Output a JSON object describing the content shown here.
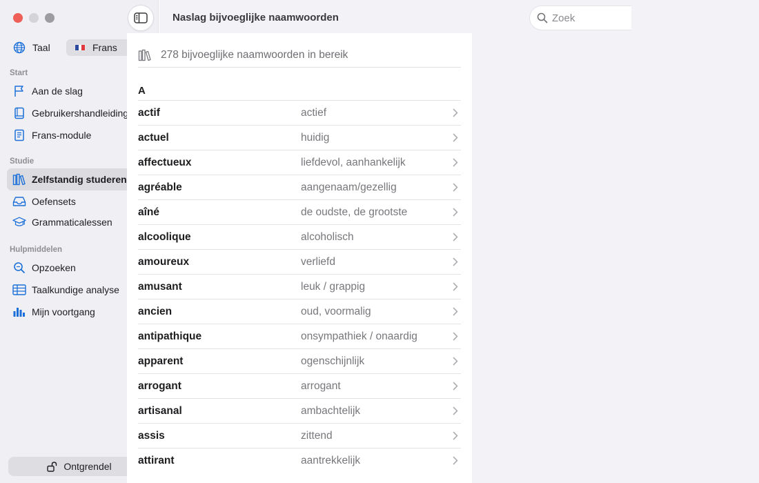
{
  "window": {
    "controls": [
      "close",
      "minimize",
      "zoom"
    ]
  },
  "sidebar": {
    "language": {
      "label": "Taal",
      "selected": "Frans",
      "flag_colors": [
        "#2b4aa0",
        "#ffffff",
        "#e0383e"
      ]
    },
    "sections": [
      {
        "title": "Start",
        "items": [
          {
            "label": "Aan de slag",
            "icon": "flag-icon"
          },
          {
            "label": "Gebruikershandleiding",
            "icon": "book-icon"
          },
          {
            "label": "Frans-module",
            "icon": "module-icon"
          }
        ]
      },
      {
        "title": "Studie",
        "items": [
          {
            "label": "Zelfstandig studeren",
            "icon": "library-icon",
            "active": true
          },
          {
            "label": "Oefensets",
            "icon": "tray-icon"
          },
          {
            "label": "Grammaticalessen",
            "icon": "graduation-cap-icon"
          }
        ]
      },
      {
        "title": "Hulpmiddelen",
        "items": [
          {
            "label": "Opzoeken",
            "icon": "magnifier-icon"
          },
          {
            "label": "Taalkundige analyse",
            "icon": "table-icon"
          },
          {
            "label": "Mijn voortgang",
            "icon": "bar-chart-icon"
          }
        ]
      }
    ],
    "unlock_label": "Ontgrendel"
  },
  "header": {
    "title": "Naslag bijvoeglijke naamwoorden",
    "search_placeholder": "Zoek"
  },
  "content": {
    "count_text": "278 bijvoeglijke naamwoorden in bereik",
    "letter": "A",
    "entries": [
      {
        "fr": "actif",
        "nl": "actief"
      },
      {
        "fr": "actuel",
        "nl": "huidig"
      },
      {
        "fr": "affectueux",
        "nl": "liefdevol, aanhankelijk"
      },
      {
        "fr": "agréable",
        "nl": "aangenaam/gezellig"
      },
      {
        "fr": "aîné",
        "nl": "de oudste, de grootste"
      },
      {
        "fr": "alcoolique",
        "nl": "alcoholisch"
      },
      {
        "fr": "amoureux",
        "nl": "verliefd"
      },
      {
        "fr": "amusant",
        "nl": "leuk / grappig"
      },
      {
        "fr": "ancien",
        "nl": "oud, voormalig"
      },
      {
        "fr": "antipathique",
        "nl": "onsympathiek / onaardig"
      },
      {
        "fr": "apparent",
        "nl": "ogenschijnlijk"
      },
      {
        "fr": "arrogant",
        "nl": "arrogant"
      },
      {
        "fr": "artisanal",
        "nl": "ambachtelijk"
      },
      {
        "fr": "assis",
        "nl": "zittend"
      },
      {
        "fr": "attirant",
        "nl": "aantrekkelijk"
      }
    ]
  },
  "colors": {
    "accent": "#1a6fd9",
    "sidebar_bg": "#f0eff4",
    "active_bg": "#dcdbe0"
  }
}
